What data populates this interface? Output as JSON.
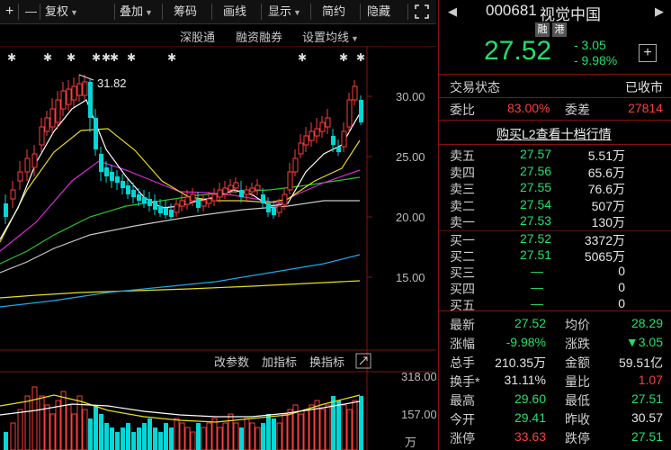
{
  "toolbar": {
    "plus": "+",
    "minus": "—",
    "fuquan": "复权",
    "diejia": "叠加",
    "chouma": "筹码",
    "huaxian": "画线",
    "xianshi": "显示",
    "jianjie": "简约",
    "yincang": "隐藏"
  },
  "links": {
    "shengutong": "深股通",
    "rongzirongquan": "融资融券",
    "set_ma": "设置均线"
  },
  "chart": {
    "high_label": "31.82",
    "price_ticks": [
      "30.00",
      "25.00",
      "20.00",
      "15.00"
    ],
    "vol_ticks": [
      "318.00",
      "157.00",
      "万"
    ],
    "params": {
      "gaicanshu": "改参数",
      "jiazhibiao": "加指标",
      "huanzhibiao": "换指标"
    },
    "marker": "✱"
  },
  "stock": {
    "code": "000681",
    "name": "视觉中国",
    "badge1": "融",
    "badge2": "港",
    "price": "27.52",
    "change": "- 3.05",
    "change_pct": "- 9.98%",
    "add": "+"
  },
  "status": {
    "label": "交易状态",
    "value": "已收市"
  },
  "webi": {
    "label": "委比",
    "value": "83.00%",
    "label2": "委差",
    "value2": "27814"
  },
  "l2_link": "购买L2查看十档行情",
  "asks": [
    {
      "label": "卖五",
      "price": "27.57",
      "vol": "5.51万"
    },
    {
      "label": "卖四",
      "price": "27.56",
      "vol": "65.6万"
    },
    {
      "label": "卖三",
      "price": "27.55",
      "vol": "76.6万"
    },
    {
      "label": "卖二",
      "price": "27.54",
      "vol": "507万"
    },
    {
      "label": "卖一",
      "price": "27.53",
      "vol": "130万"
    }
  ],
  "bids": [
    {
      "label": "买一",
      "price": "27.52",
      "vol": "3372万"
    },
    {
      "label": "买二",
      "price": "27.51",
      "vol": "5065万"
    },
    {
      "label": "买三",
      "price": "—",
      "vol": "0"
    },
    {
      "label": "买四",
      "price": "—",
      "vol": "0"
    },
    {
      "label": "买五",
      "price": "—",
      "vol": "0"
    }
  ],
  "stats": [
    {
      "l1": "最新",
      "v1": "27.52",
      "c1": "grn",
      "l2": "均价",
      "v2": "28.29",
      "c2": "grn"
    },
    {
      "l1": "涨幅",
      "v1": "-9.98%",
      "c1": "grn",
      "l2": "涨跌",
      "v2": "▼3.05",
      "c2": "grn"
    },
    {
      "l1": "总手",
      "v1": "210.35万",
      "c1": "wht",
      "l2": "金额",
      "v2": "59.51亿",
      "c2": "wht"
    },
    {
      "l1": "换手*",
      "v1": "31.11%",
      "c1": "wht",
      "l2": "量比",
      "v2": "1.07",
      "c2": "red"
    },
    {
      "l1": "最高",
      "v1": "29.60",
      "c1": "grn",
      "l2": "最低",
      "v2": "27.51",
      "c2": "grn"
    },
    {
      "l1": "今开",
      "v1": "29.41",
      "c1": "grn",
      "l2": "昨收",
      "v2": "30.57",
      "c2": "wht"
    },
    {
      "l1": "涨停",
      "v1": "33.63",
      "c1": "red",
      "l2": "跌停",
      "v2": "27.51",
      "c2": "grn"
    }
  ],
  "colors": {
    "up": "#ff3d3d",
    "down": "#00d8d8",
    "border": "#8a1010"
  }
}
